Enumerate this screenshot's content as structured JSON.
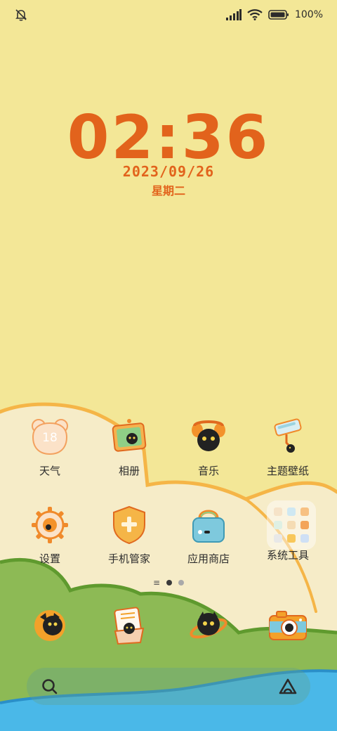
{
  "status_bar": {
    "icons": [
      "bell-off-icon",
      "signal-icon",
      "wifi-icon",
      "battery-icon"
    ],
    "battery_text": "100%"
  },
  "clock": {
    "time": "02:36",
    "date": "2023/09/26",
    "weekday": "星期二"
  },
  "apps": [
    {
      "label": "天气",
      "icon": "weather-icon",
      "temp": "18"
    },
    {
      "label": "相册",
      "icon": "gallery-icon"
    },
    {
      "label": "音乐",
      "icon": "music-icon"
    },
    {
      "label": "主题壁纸",
      "icon": "theme-icon"
    },
    {
      "label": "设置",
      "icon": "settings-icon"
    },
    {
      "label": "手机管家",
      "icon": "phone-manager-icon"
    },
    {
      "label": "应用商店",
      "icon": "app-store-icon"
    },
    {
      "label": "系统工具",
      "icon": "system-tools-folder-icon"
    }
  ],
  "pager": {
    "pages": 2,
    "active_index": 0
  },
  "dock": [
    "phone-icon",
    "messages-icon",
    "browser-icon",
    "camera-icon"
  ],
  "search": {
    "icons": [
      "search-icon",
      "assistant-icon"
    ]
  },
  "colors": {
    "accent": "#e2631c",
    "sky": "#f3e797",
    "grass": "#8dba55",
    "water": "#4ab8e8"
  }
}
